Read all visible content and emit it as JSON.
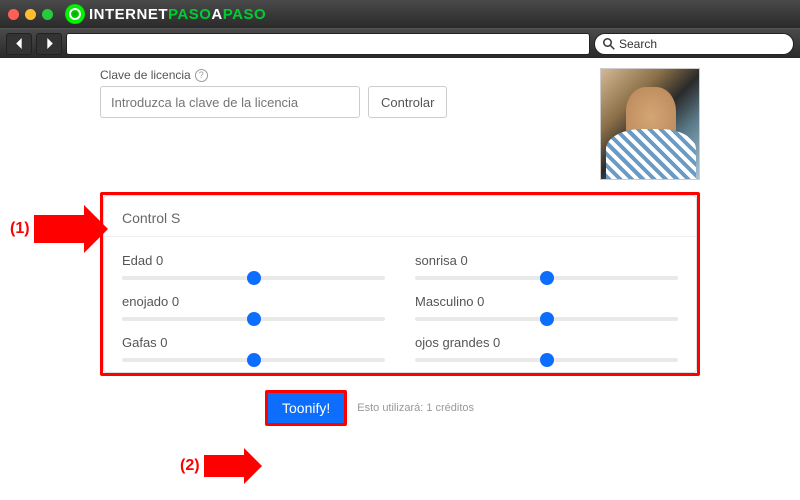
{
  "browser": {
    "logo_white": "INTERNET",
    "logo_green1": "PASO",
    "logo_white2": "A",
    "logo_green2": "PASO",
    "search_placeholder": "Search"
  },
  "license": {
    "label": "Clave de licencia",
    "info": "?",
    "placeholder": "Introduzca la clave de la licencia",
    "button": "Controlar"
  },
  "panel": {
    "title": "Control S",
    "sliders": [
      {
        "label": "Edad",
        "value": 0
      },
      {
        "label": "sonrisa",
        "value": 0
      },
      {
        "label": "enojado",
        "value": 0
      },
      {
        "label": "Masculino",
        "value": 0
      },
      {
        "label": "Gafas",
        "value": 0
      },
      {
        "label": "ojos grandes",
        "value": 0
      }
    ]
  },
  "action": {
    "button": "Toonify!",
    "credits": "Esto utilizará: 1 créditos"
  },
  "annotations": {
    "one": "(1)",
    "two": "(2)"
  }
}
